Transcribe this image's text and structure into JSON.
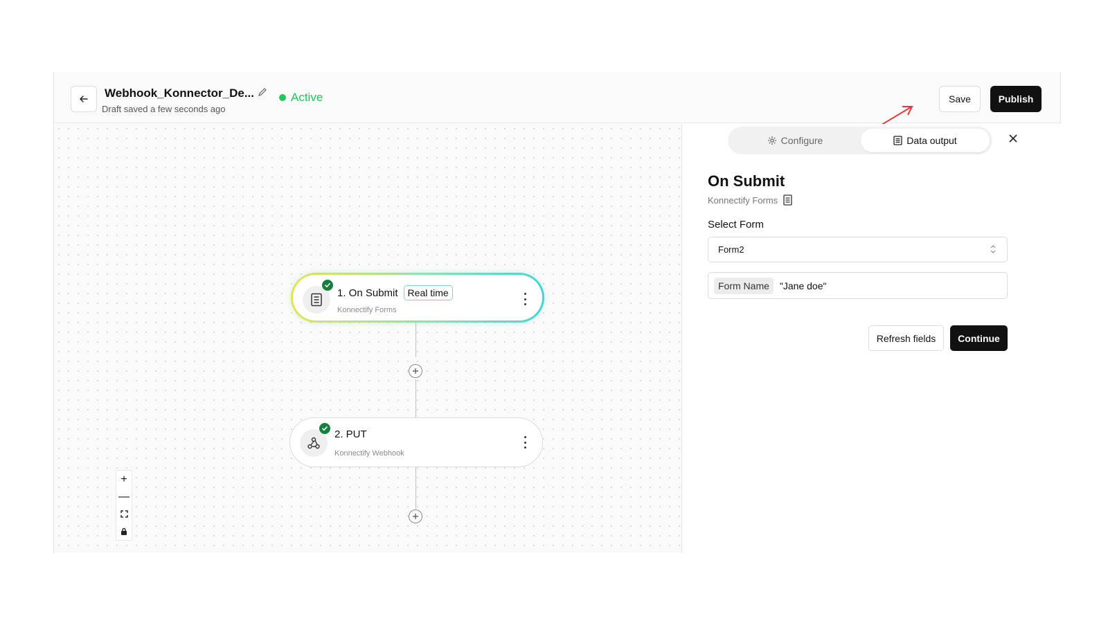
{
  "header": {
    "title": "Webhook_Konnector_De...",
    "subtitle": "Draft saved a few seconds ago",
    "status": "Active",
    "save_label": "Save",
    "publish_label": "Publish"
  },
  "canvas": {
    "nodes": [
      {
        "title": "1. On Submit",
        "badge": "Real time",
        "subtitle": "Konnectify Forms",
        "icon": "form-icon"
      },
      {
        "title": "2. PUT",
        "subtitle": "Konnectify Webhook",
        "icon": "webhook-icon"
      }
    ],
    "zoom_controls": {
      "zoom_in": "+",
      "zoom_out": "—"
    }
  },
  "panel": {
    "tabs": [
      {
        "label": "Configure",
        "icon": "gear-icon"
      },
      {
        "label": "Data output",
        "icon": "document-icon",
        "active": true
      }
    ],
    "title": "On Submit",
    "subtitle": "Konnectify Forms",
    "select_label": "Select Form",
    "select_value": "Form2",
    "field_key": "Form Name",
    "field_value": "\"Jane doe\"",
    "refresh_label": "Refresh fields",
    "continue_label": "Continue"
  },
  "colors": {
    "accent_active": "#22c55e",
    "primary_button": "#111111",
    "annotation_arrow": "#e53935"
  }
}
